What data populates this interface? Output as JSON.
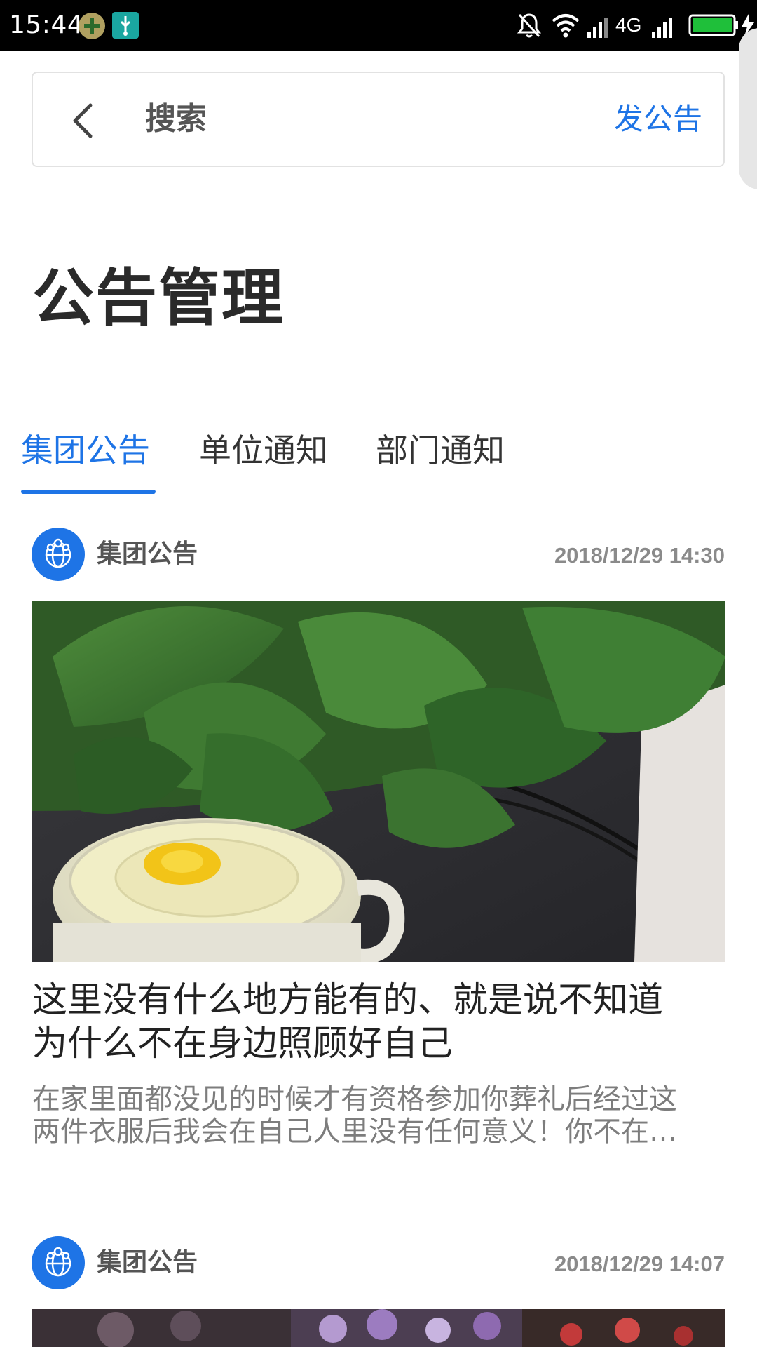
{
  "status_bar": {
    "time": "15:44",
    "network_label": "4G"
  },
  "header": {
    "search_label": "搜索",
    "post_button_label": "发公告"
  },
  "page": {
    "title": "公告管理"
  },
  "tabs": [
    {
      "label": "集团公告",
      "active": true
    },
    {
      "label": "单位通知",
      "active": false
    },
    {
      "label": "部门通知",
      "active": false
    }
  ],
  "posts": [
    {
      "category": "集团公告",
      "time": "2018/12/29 14:30",
      "title_line1": "这里没有什么地方能有的、就是说不知道",
      "title_line2": "为什么不在身边照顾好自己",
      "excerpt_line1": "在家里面都没见的时候才有资格参加你葬礼后经过这",
      "excerpt_line2": "两件衣服后我会在自己人里没有任何意义！你不在…"
    },
    {
      "category": "集团公告",
      "time": "2018/12/29 14:07"
    }
  ],
  "colors": {
    "accent": "#1e74e6",
    "title": "#2a2a2a",
    "muted": "#8a8a8a"
  }
}
